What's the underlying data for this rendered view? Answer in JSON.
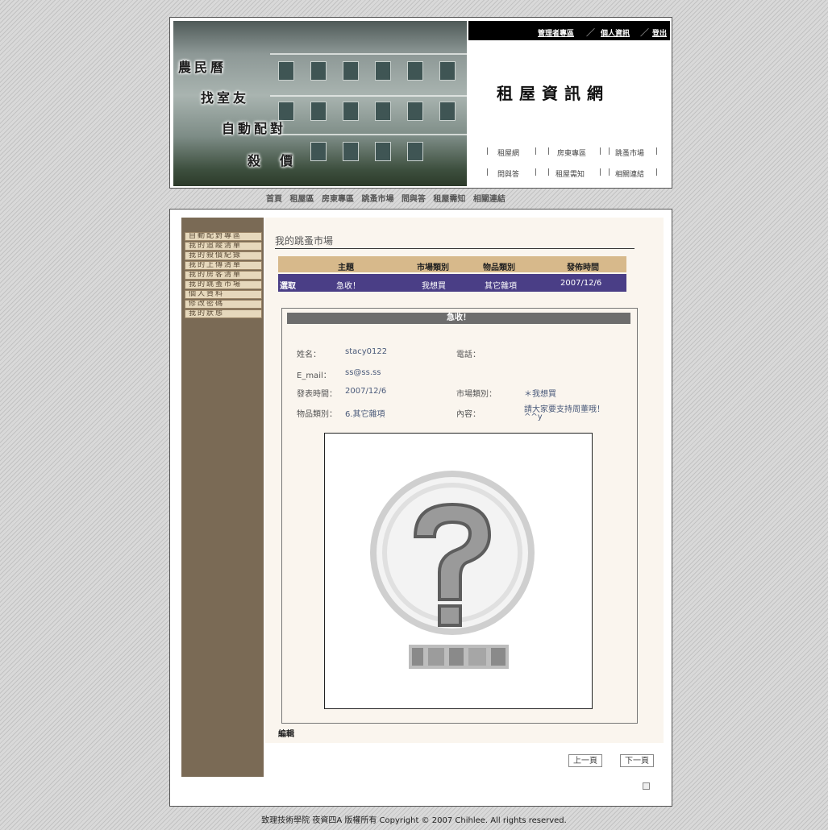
{
  "header": {
    "banner_lines": [
      "農民曆",
      "找室友",
      "自動配對",
      "殺　價"
    ],
    "top_links": [
      "管理者專區",
      "個人資訊",
      "登出"
    ],
    "separator": "／",
    "site_title": "租屋資訊網",
    "nav_row1": [
      "租屋網",
      "房東專區",
      "跳蚤市場"
    ],
    "nav_row2": [
      "問與答",
      "租屋需知",
      "相關連結"
    ],
    "nav_pipe": "|"
  },
  "subnav": [
    "首頁",
    "租屋區",
    "房東專區",
    "跳蚤市場",
    "問與答",
    "租屋需知",
    "相關連結"
  ],
  "sidebar": {
    "items": [
      "自動配對專區",
      "我的追蹤清單",
      "我的殺價紀錄",
      "我的上傳清單",
      "我的房客清單",
      "我的跳蚤市場",
      "個人資料",
      "修改密碼",
      "我的狀態"
    ]
  },
  "content": {
    "title": "我的跳蚤市場",
    "table": {
      "headers": [
        "主題",
        "市場類別",
        "物品類別",
        "發佈時間"
      ],
      "row": {
        "action": "選取",
        "subject": "急收！",
        "market": "我想買",
        "category": "其它雜項",
        "date": "2007/12/6"
      }
    },
    "detail": {
      "title": "急收！",
      "name_label": "姓名：",
      "name": "stacy0122",
      "phone_label": "電話：",
      "email_label": "E_mail：",
      "email": "ss@ss.ss",
      "posted_label": "發表時間：",
      "posted": "2007/12/6",
      "market_label": "市場類別：",
      "market": "＊我想買",
      "category_label": "物品類別：",
      "category": "6.其它雜項",
      "content_label": "內容：",
      "content_line1": "請大家要支持周董哦！",
      "content_line2": "^^y"
    },
    "edit_label": "編輯",
    "prev_label": "上一頁",
    "next_label": "下一頁"
  },
  "footer": "致理技術學院 夜資四A 版權所有 Copyright © 2007 Chihlee. All rights reserved."
}
